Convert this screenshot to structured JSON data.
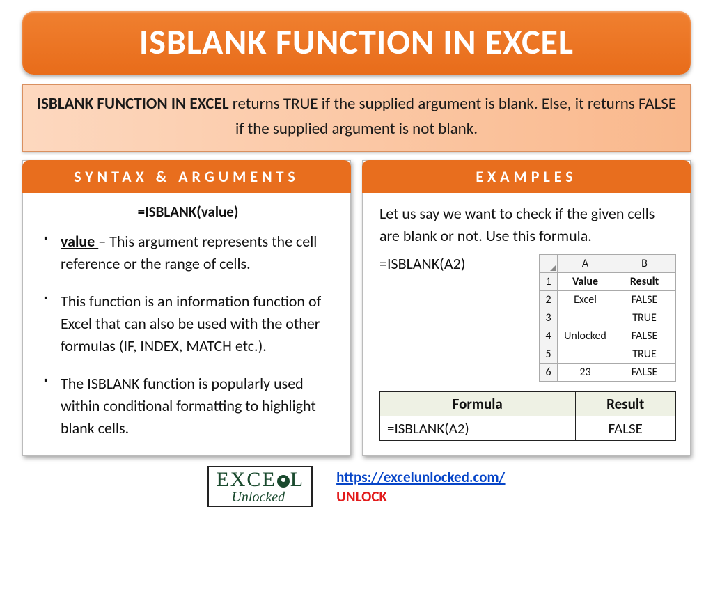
{
  "title": "ISBLANK FUNCTION IN EXCEL",
  "description": {
    "bold": "ISBLANK FUNCTION IN EXCEL",
    "rest": " returns TRUE if the supplied argument is blank. Else, it returns FALSE if the supplied argument is not blank."
  },
  "syntax_card": {
    "header": "SYNTAX & ARGUMENTS",
    "formula": "=ISBLANK(value)",
    "items": [
      {
        "term": "value ",
        "text": "– This argument represents the cell reference or the range of cells."
      },
      {
        "text": "This function is an information function of Excel that can also be used with the other formulas (IF, INDEX, MATCH etc.)."
      },
      {
        "text": "The ISBLANK function is popularly used within conditional formatting to highlight blank cells."
      }
    ]
  },
  "examples_card": {
    "header": "EXAMPLES",
    "intro": "Let us say we want to check if the given cells are blank or not. Use this formula.",
    "formula": "=ISBLANK(A2)",
    "sheet": {
      "col_a": "A",
      "col_b": "B",
      "headers": {
        "a": "Value",
        "b": "Result"
      },
      "rows": [
        {
          "n": "1"
        },
        {
          "n": "2",
          "a": "Excel",
          "b": "FALSE"
        },
        {
          "n": "3",
          "a": "",
          "b": "TRUE"
        },
        {
          "n": "4",
          "a": "Unlocked",
          "b": "FALSE"
        },
        {
          "n": "5",
          "a": "",
          "b": "TRUE"
        },
        {
          "n": "6",
          "a": "23",
          "b": "FALSE"
        }
      ]
    },
    "result_table": {
      "h1": "Formula",
      "h2": "Result",
      "formula": "=ISBLANK(A2)",
      "result": "FALSE"
    }
  },
  "footer": {
    "logo_top_pre": "EXCE",
    "logo_top_post": "L",
    "logo_bottom": "Unlocked",
    "url": "https://excelunlocked.com/",
    "unlock": "UNLOCK"
  }
}
